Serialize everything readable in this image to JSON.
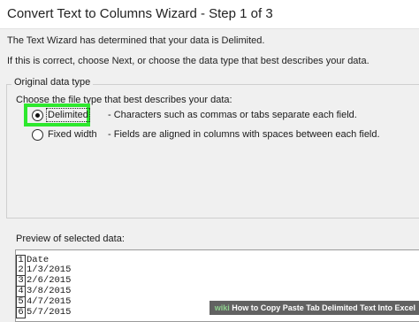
{
  "window": {
    "title": "Convert Text to Columns Wizard - Step 1 of 3"
  },
  "intro": {
    "line1": "The Text Wizard has determined that your data is Delimited.",
    "line2": "If this is correct, choose Next, or choose the data type that best describes your data."
  },
  "original_type": {
    "legend": "Original data type",
    "prompt": "Choose the file type that best describes your data:",
    "options": [
      {
        "label": "Delimited",
        "description": "- Characters such as commas or tabs separate each field.",
        "selected": true
      },
      {
        "label": "Fixed width",
        "description": "- Fields are aligned in columns with spaces between each field.",
        "selected": false
      }
    ],
    "highlight_color": "#2ee82e"
  },
  "preview": {
    "label": "Preview of selected data:",
    "rows": [
      {
        "num": "1",
        "value": "Date"
      },
      {
        "num": "2",
        "value": "1/3/2015"
      },
      {
        "num": "3",
        "value": "2/6/2015"
      },
      {
        "num": "4",
        "value": "3/8/2015"
      },
      {
        "num": "5",
        "value": "4/7/2015"
      },
      {
        "num": "6",
        "value": "5/7/2015"
      }
    ]
  },
  "watermark": {
    "brand": "wiki",
    "text": "How to Copy Paste Tab Delimited Text Into Excel"
  }
}
